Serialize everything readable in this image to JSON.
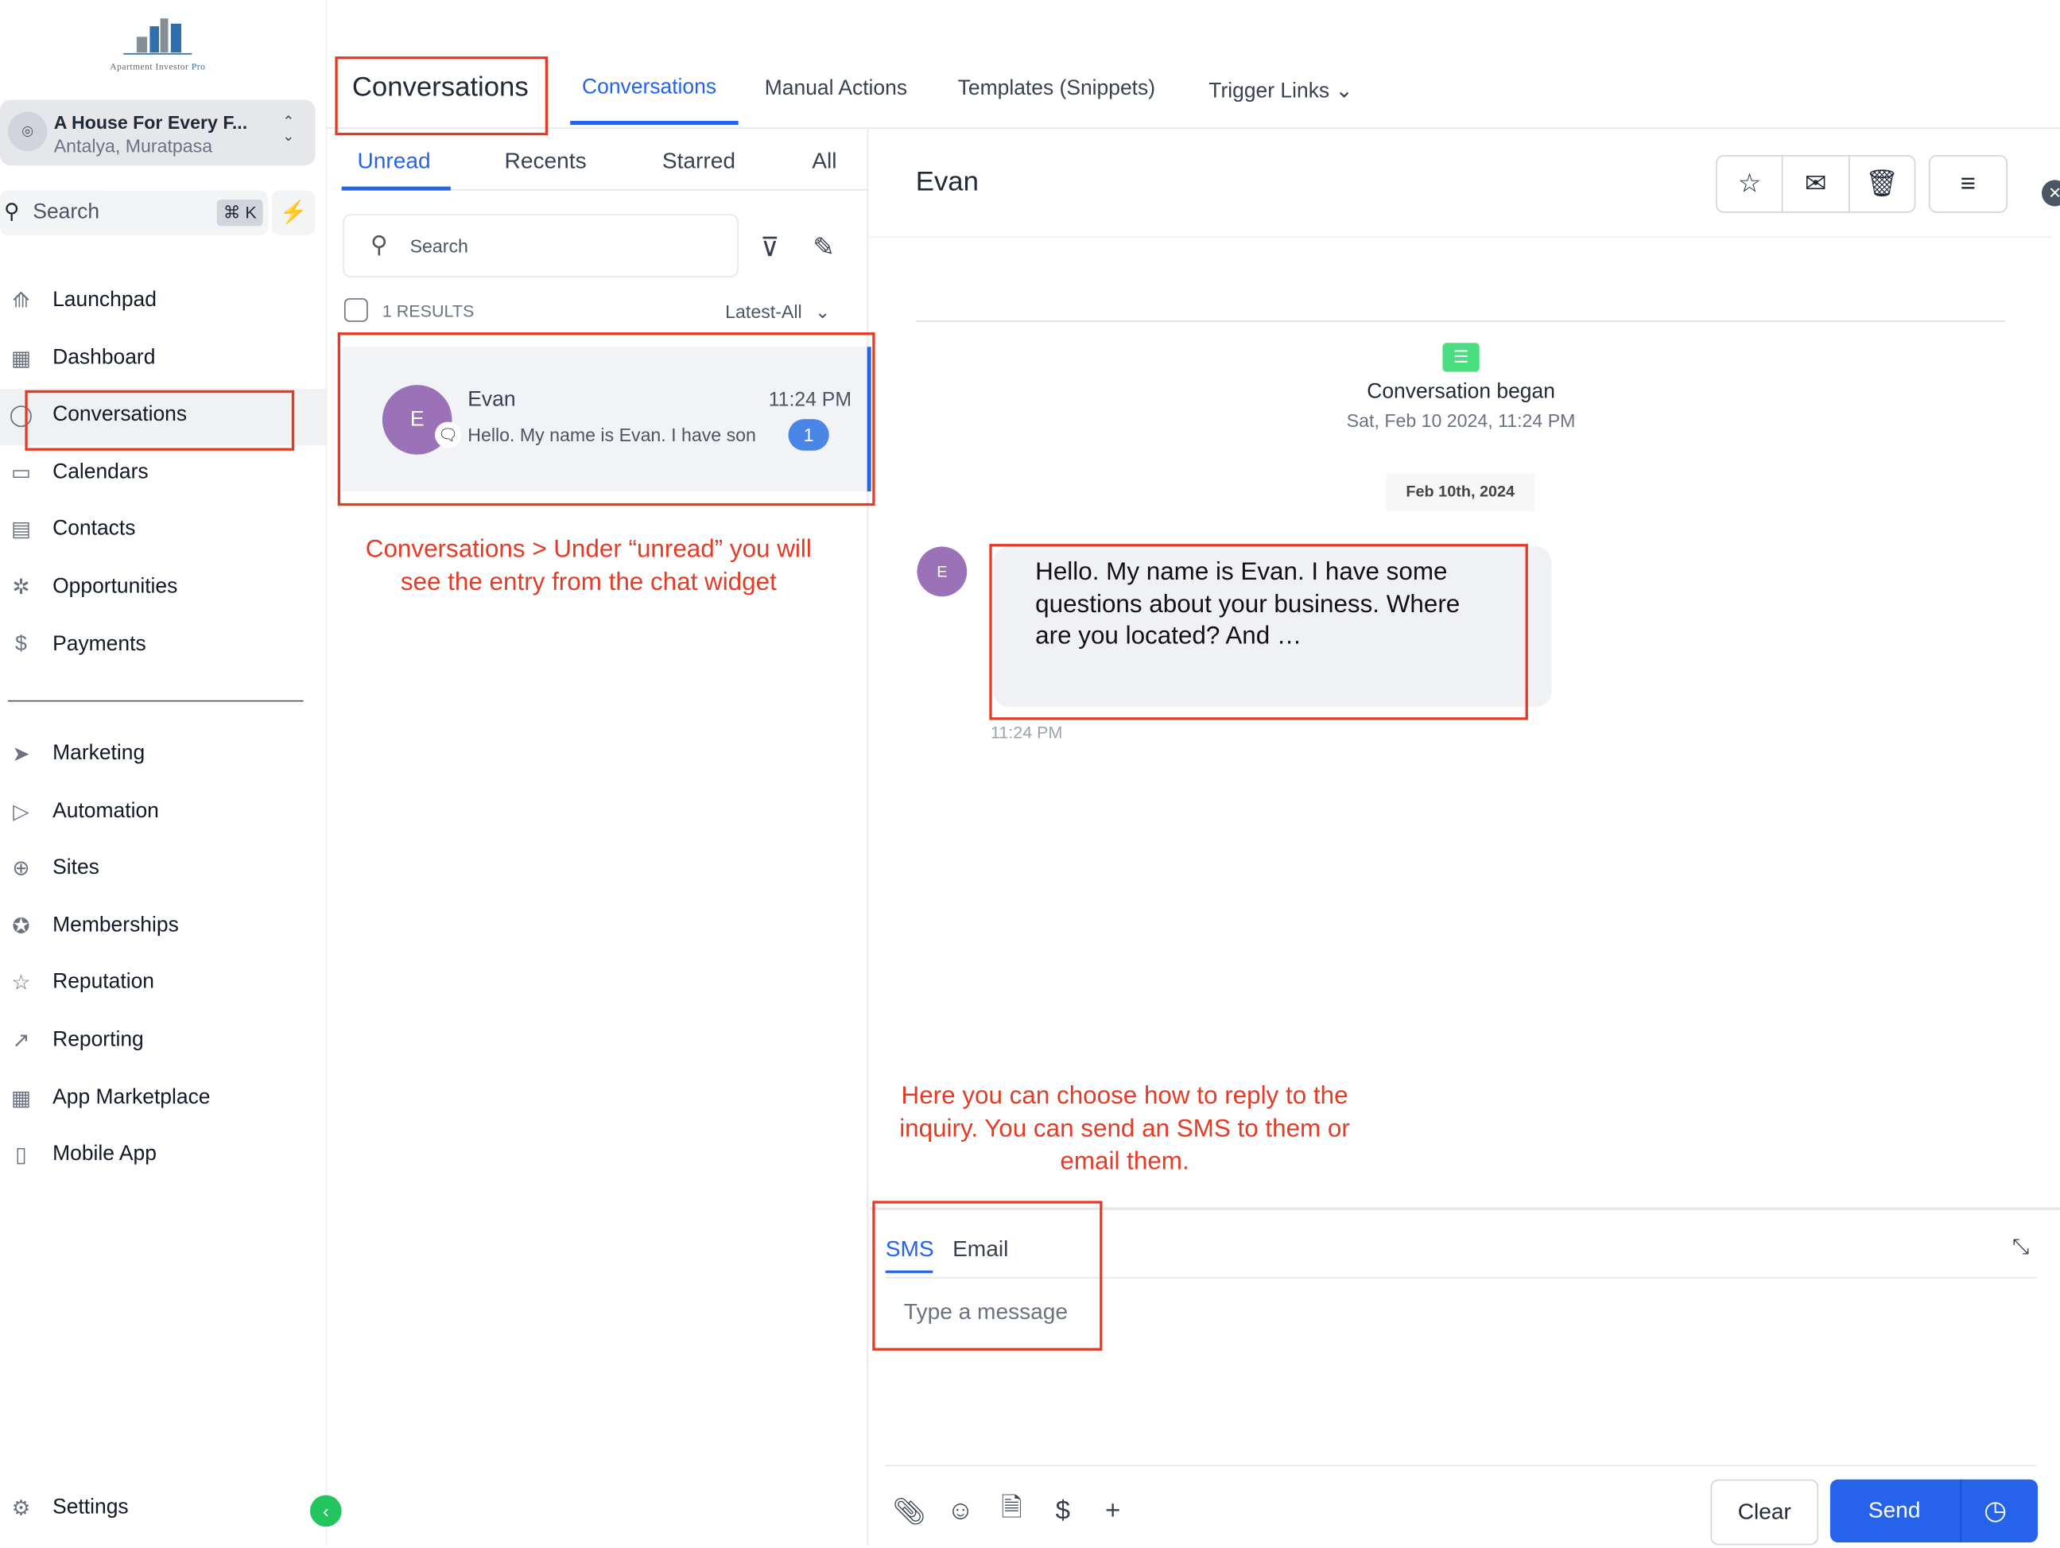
{
  "logo": {
    "text": "Apartment Investor",
    "accent": "Pro"
  },
  "location": {
    "name": "A House For Every F...",
    "sub": "Antalya, Muratpasa"
  },
  "search": {
    "placeholder": "Search",
    "shortcut": "⌘ K"
  },
  "sidebar": {
    "items": [
      {
        "label": "Launchpad",
        "icon": "rocket-icon",
        "glyph": "⟰"
      },
      {
        "label": "Dashboard",
        "icon": "dashboard-icon",
        "glyph": "▦"
      },
      {
        "label": "Conversations",
        "icon": "chat-icon",
        "glyph": "◯"
      },
      {
        "label": "Calendars",
        "icon": "calendar-icon",
        "glyph": "▭"
      },
      {
        "label": "Contacts",
        "icon": "contacts-icon",
        "glyph": "▤"
      },
      {
        "label": "Opportunities",
        "icon": "opportunities-icon",
        "glyph": "✲"
      },
      {
        "label": "Payments",
        "icon": "payments-icon",
        "glyph": "$"
      }
    ],
    "items2": [
      {
        "label": "Marketing",
        "icon": "send-icon",
        "glyph": "➤"
      },
      {
        "label": "Automation",
        "icon": "automation-icon",
        "glyph": "▷"
      },
      {
        "label": "Sites",
        "icon": "sites-icon",
        "glyph": "⊕"
      },
      {
        "label": "Memberships",
        "icon": "memberships-icon",
        "glyph": "✪"
      },
      {
        "label": "Reputation",
        "icon": "star-icon",
        "glyph": "☆"
      },
      {
        "label": "Reporting",
        "icon": "reporting-icon",
        "glyph": "↗"
      },
      {
        "label": "App Marketplace",
        "icon": "marketplace-icon",
        "glyph": "▦"
      },
      {
        "label": "Mobile App",
        "icon": "mobile-icon",
        "glyph": "▯"
      }
    ],
    "settings": "Settings"
  },
  "header": {
    "title": "Conversations",
    "tabs": [
      "Conversations",
      "Manual Actions",
      "Templates (Snippets)",
      "Trigger Links"
    ]
  },
  "list": {
    "tabs": [
      "Unread",
      "Recents",
      "Starred",
      "All"
    ],
    "search_placeholder": "Search",
    "results": "1 RESULTS",
    "sort": "Latest-All",
    "items": [
      {
        "initial": "E",
        "name": "Evan",
        "time": "11:24 PM",
        "preview": "Hello. My name is Evan. I have son",
        "unread": "1"
      }
    ]
  },
  "chat": {
    "contact": "Evan",
    "began": "Conversation began",
    "began_date": "Sat, Feb 10 2024, 11:24 PM",
    "date_chip": "Feb 10th, 2024",
    "message": {
      "initial": "E",
      "text": "Hello. My name is Evan. I have some questions about your business. Where are you located? And …",
      "time": "11:24 PM"
    }
  },
  "composer": {
    "tabs": [
      "SMS",
      "Email"
    ],
    "placeholder": "Type a message",
    "clear": "Clear",
    "send": "Send"
  },
  "annotations": {
    "a1": "Conversations > Under  “unread” you will see the entry from the chat widget",
    "a2": "Here you can choose how to reply to the inquiry. You can send an SMS to them or email them."
  },
  "colors": {
    "accent": "#2563eb",
    "annotation": "#e53a24",
    "avatar": "#9b72b8"
  }
}
